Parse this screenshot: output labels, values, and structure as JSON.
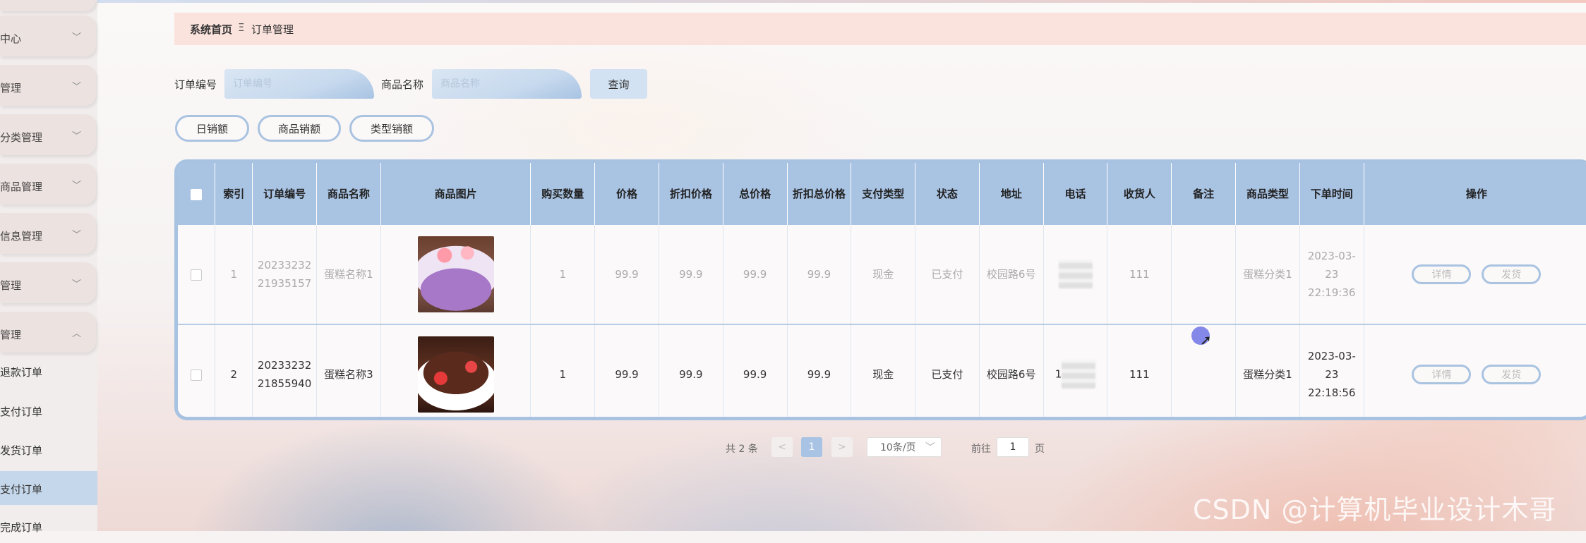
{
  "sidebar": {
    "items": [
      {
        "label": "中心"
      },
      {
        "label": "管理"
      },
      {
        "label": "分类管理"
      },
      {
        "label": "商品管理"
      },
      {
        "label": "信息管理"
      },
      {
        "label": "管理"
      },
      {
        "label": "管理"
      }
    ],
    "sub_items": [
      {
        "label": "退款订单"
      },
      {
        "label": "支付订单"
      },
      {
        "label": "发货订单"
      },
      {
        "label": "支付订单"
      },
      {
        "label": "完成订单"
      }
    ]
  },
  "breadcrumb": {
    "home": "系统首页",
    "separator": "Ξ",
    "current": "订单管理"
  },
  "search": {
    "order_no_label": "订单编号",
    "order_no_placeholder": "订单编号",
    "product_label": "商品名称",
    "product_placeholder": "商品名称",
    "query_button": "查询"
  },
  "stats": {
    "daily": "日销额",
    "product": "商品销额",
    "type": "类型销额"
  },
  "table": {
    "headers": [
      "索引",
      "订单编号",
      "商品名称",
      "商品图片",
      "购买数量",
      "价格",
      "折扣价格",
      "总价格",
      "折扣总价格",
      "支付类型",
      "状态",
      "地址",
      "电话",
      "收货人",
      "备注",
      "商品类型",
      "下单时间",
      "操作"
    ],
    "rows": [
      {
        "index": "1",
        "order_no": "2023323221935157",
        "product": "蛋糕名称1",
        "qty": "1",
        "price": "99.9",
        "discount_price": "99.9",
        "total": "99.9",
        "discount_total": "99.9",
        "pay_type": "现金",
        "status": "已支付",
        "address": "校园路6号",
        "phone": "",
        "receiver": "111",
        "note": "",
        "category": "蛋糕分类1",
        "time": "2023-03-23 22:19:36"
      },
      {
        "index": "2",
        "order_no": "2023323221855940",
        "product": "蛋糕名称3",
        "qty": "1",
        "price": "99.9",
        "discount_price": "99.9",
        "total": "99.9",
        "discount_total": "99.9",
        "pay_type": "现金",
        "status": "已支付",
        "address": "校园路6号",
        "phone": "1",
        "receiver": "111",
        "note": "",
        "category": "蛋糕分类1",
        "time": "2023-03-23 22:18:56"
      }
    ],
    "actions": {
      "detail": "详情",
      "ship": "发货"
    }
  },
  "pagination": {
    "total": "共 2 条",
    "prev": "<",
    "current": "1",
    "next": ">",
    "page_size": "10条/页",
    "goto": "前往",
    "goto_value": "1",
    "page_unit": "页"
  },
  "watermark": "CSDN @计算机毕业设计木哥"
}
